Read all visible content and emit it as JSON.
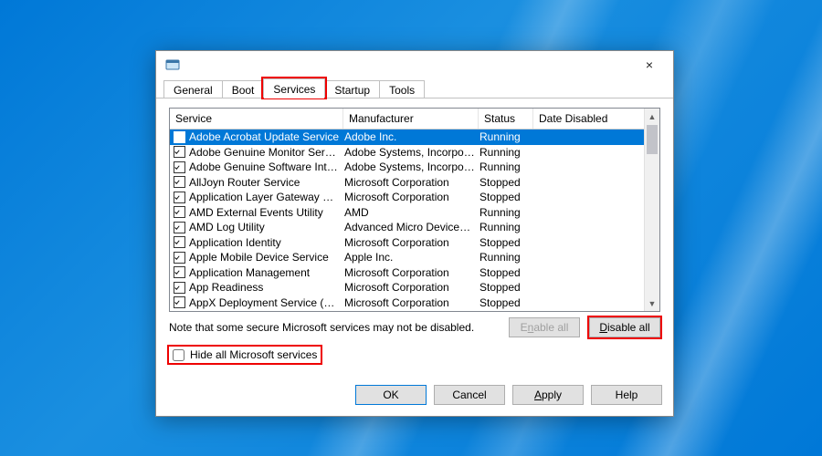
{
  "dialog": {
    "close_icon": "×"
  },
  "tabs": {
    "general": "General",
    "boot": "Boot",
    "services": "Services",
    "startup": "Startup",
    "tools": "Tools"
  },
  "columns": {
    "service": "Service",
    "manufacturer": "Manufacturer",
    "status": "Status",
    "date_disabled": "Date Disabled"
  },
  "rows": [
    {
      "svc": "Adobe Acrobat Update Service",
      "mfr": "Adobe Inc.",
      "status": "Running",
      "selected": true
    },
    {
      "svc": "Adobe Genuine Monitor Service",
      "mfr": "Adobe Systems, Incorpora...",
      "status": "Running"
    },
    {
      "svc": "Adobe Genuine Software Integri...",
      "mfr": "Adobe Systems, Incorpora...",
      "status": "Running"
    },
    {
      "svc": "AllJoyn Router Service",
      "mfr": "Microsoft Corporation",
      "status": "Stopped"
    },
    {
      "svc": "Application Layer Gateway Service",
      "mfr": "Microsoft Corporation",
      "status": "Stopped"
    },
    {
      "svc": "AMD External Events Utility",
      "mfr": "AMD",
      "status": "Running"
    },
    {
      "svc": "AMD Log Utility",
      "mfr": "Advanced Micro Devices, I...",
      "status": "Running"
    },
    {
      "svc": "Application Identity",
      "mfr": "Microsoft Corporation",
      "status": "Stopped"
    },
    {
      "svc": "Apple Mobile Device Service",
      "mfr": "Apple Inc.",
      "status": "Running"
    },
    {
      "svc": "Application Management",
      "mfr": "Microsoft Corporation",
      "status": "Stopped"
    },
    {
      "svc": "App Readiness",
      "mfr": "Microsoft Corporation",
      "status": "Stopped"
    },
    {
      "svc": "AppX Deployment Service (AppX...",
      "mfr": "Microsoft Corporation",
      "status": "Stopped"
    }
  ],
  "note": "Note that some secure Microsoft services may not be disabled.",
  "buttons": {
    "enable_all_pre": "E",
    "enable_all_ul": "n",
    "enable_all_post": "able all",
    "disable_all_pre": "",
    "disable_all_ul": "D",
    "disable_all_post": "isable all",
    "hide_pre": "",
    "hide_ul": "H",
    "hide_post": "ide all Microsoft services",
    "ok": "OK",
    "cancel": "Cancel",
    "apply_pre": "",
    "apply_ul": "A",
    "apply_post": "pply",
    "help": "Help"
  }
}
